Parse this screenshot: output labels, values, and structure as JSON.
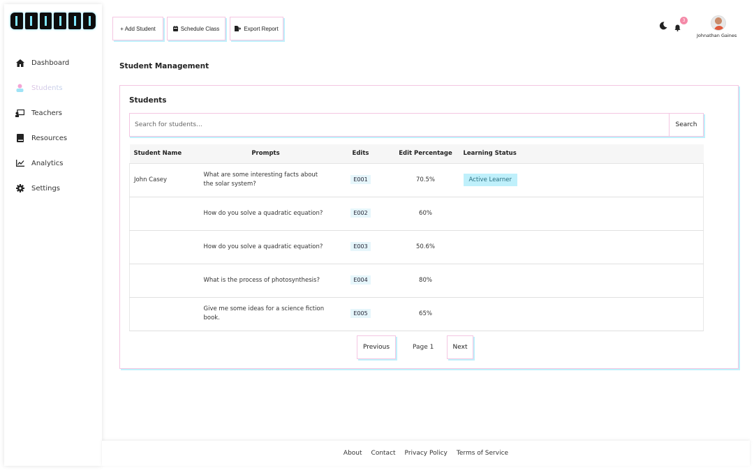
{
  "brand": {
    "logo_text": "GUIDED"
  },
  "sidebar": {
    "items": [
      {
        "label": "Dashboard",
        "icon": "home-icon"
      },
      {
        "label": "Students",
        "icon": "students-icon",
        "active": true
      },
      {
        "label": "Teachers",
        "icon": "teacher-icon"
      },
      {
        "label": "Resources",
        "icon": "book-icon"
      },
      {
        "label": "Analytics",
        "icon": "chart-icon"
      },
      {
        "label": "Settings",
        "icon": "gear-icon"
      }
    ]
  },
  "toolbar": {
    "add_student": "+ Add Student",
    "schedule_class": "Schedule Class",
    "export_report": "Export Report"
  },
  "header": {
    "notification_count": "3",
    "username": "Johnathan Gaines"
  },
  "page": {
    "title": "Student Management"
  },
  "students_card": {
    "title": "Students",
    "search_placeholder": "Search for students...",
    "search_button": "Search",
    "columns": [
      "Student Name",
      "Prompts",
      "Edits",
      "Edit Percentage",
      "Learning Status"
    ],
    "rows": [
      {
        "name": "John Casey",
        "prompt": "What are some interesting facts about the solar system?",
        "edit": "E001",
        "pct": "70.5%",
        "status": "Active Learner"
      },
      {
        "name": "",
        "prompt": "How do you solve a quadratic equation?",
        "edit": "E002",
        "pct": "60%",
        "status": ""
      },
      {
        "name": "",
        "prompt": "How do you solve a quadratic equation?",
        "edit": "E003",
        "pct": "50.6%",
        "status": ""
      },
      {
        "name": "",
        "prompt": "What is the process of photosynthesis?",
        "edit": "E004",
        "pct": "80%",
        "status": ""
      },
      {
        "name": "",
        "prompt": "Give me some ideas for a science fiction book.",
        "edit": "E005",
        "pct": "65%",
        "status": ""
      }
    ],
    "pagination": {
      "previous": "Previous",
      "page_label": "Page 1",
      "next": "Next"
    }
  },
  "footer": {
    "links": [
      "About",
      "Contact",
      "Privacy Policy",
      "Terms of Service"
    ]
  },
  "colors": {
    "accent_pink": "#f4c6e2",
    "accent_cyan": "#bff0fb",
    "status_bg": "#bff0fb"
  }
}
